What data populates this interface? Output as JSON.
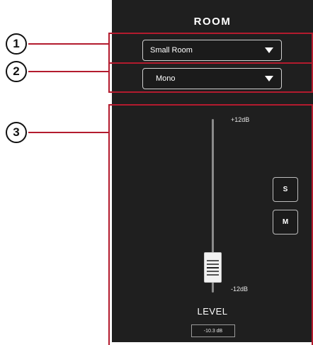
{
  "panel": {
    "title": "ROOM"
  },
  "room_dropdown": {
    "value": "Small Room"
  },
  "mode_dropdown": {
    "value": "Mono"
  },
  "fader": {
    "max_label": "+12dB",
    "min_label": "-12dB",
    "label": "LEVEL",
    "value_text": "-10.3 dB",
    "level_fraction": 0.07
  },
  "buttons": {
    "solo_label": "S",
    "mute_label": "M"
  },
  "callouts": [
    "1",
    "2",
    "3"
  ],
  "colors": {
    "panel_bg": "#1f1f1f",
    "callout": "#b31b2e",
    "text": "#ffffff"
  }
}
